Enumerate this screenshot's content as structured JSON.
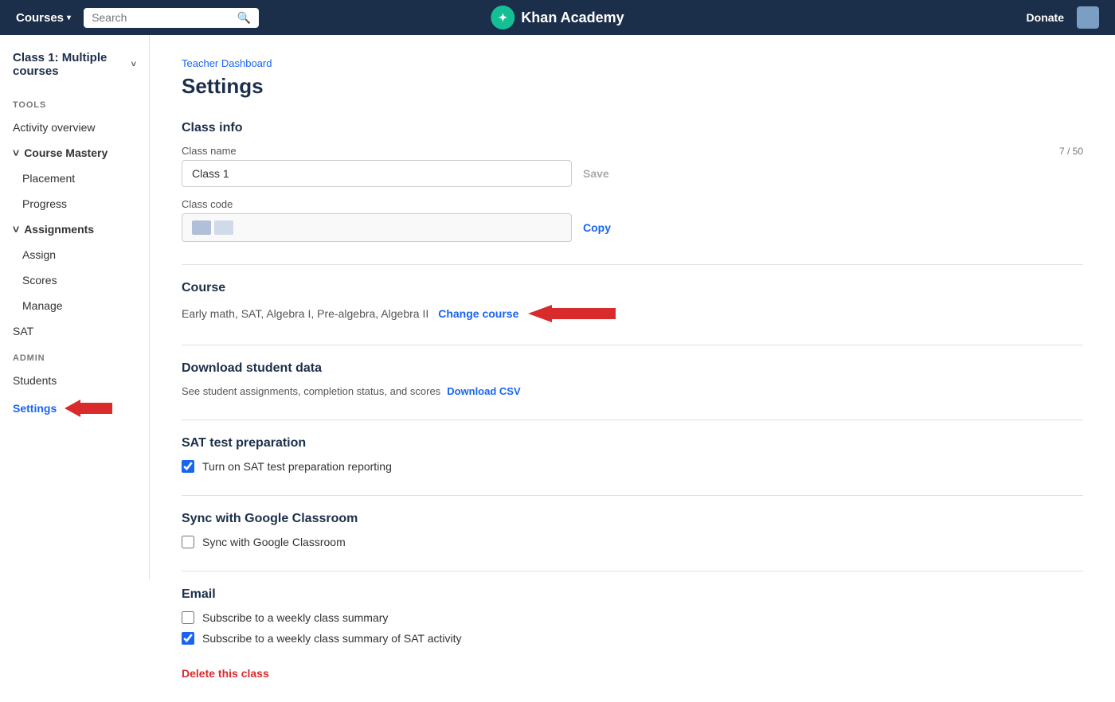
{
  "topnav": {
    "courses_label": "Courses",
    "search_placeholder": "Search",
    "logo_text": "Khan Academy",
    "logo_icon": "✦",
    "donate_label": "Donate"
  },
  "sidebar": {
    "class_name": "Class 1: Multiple courses",
    "tools_label": "TOOLS",
    "items": [
      {
        "id": "activity-overview",
        "label": "Activity overview",
        "indented": false,
        "active": false
      },
      {
        "id": "course-mastery",
        "label": "Course Mastery",
        "indented": false,
        "active": false,
        "parent": true
      },
      {
        "id": "placement",
        "label": "Placement",
        "indented": true,
        "active": false
      },
      {
        "id": "progress",
        "label": "Progress",
        "indented": true,
        "active": false
      }
    ],
    "admin_label": "ADMIN",
    "assignments_label": "Assignments",
    "assign_label": "Assign",
    "scores_label": "Scores",
    "manage_label": "Manage",
    "sat_label": "SAT",
    "students_label": "Students",
    "settings_label": "Settings"
  },
  "breadcrumb": "Teacher Dashboard",
  "page_title": "Settings",
  "class_info": {
    "section_title": "Class info",
    "class_name_label": "Class name",
    "char_count": "7 / 50",
    "class_name_value": "Class 1",
    "save_label": "Save",
    "class_code_label": "Class code",
    "copy_label": "Copy"
  },
  "course": {
    "section_title": "Course",
    "courses_text": "Early math, SAT, Algebra I, Pre-algebra, Algebra II",
    "change_course_label": "Change course"
  },
  "download": {
    "section_title": "Download student data",
    "description": "See student assignments, completion status, and scores",
    "download_csv_label": "Download CSV"
  },
  "sat": {
    "section_title": "SAT test preparation",
    "checkbox_label": "Turn on SAT test preparation reporting",
    "checked": true
  },
  "sync": {
    "section_title": "Sync with Google Classroom",
    "checkbox_label": "Sync with Google Classroom",
    "checked": false
  },
  "email": {
    "section_title": "Email",
    "weekly_summary_label": "Subscribe to a weekly class summary",
    "weekly_summary_checked": false,
    "sat_summary_label": "Subscribe to a weekly class summary of SAT activity",
    "sat_summary_checked": true
  },
  "delete": {
    "label": "Delete this class"
  }
}
